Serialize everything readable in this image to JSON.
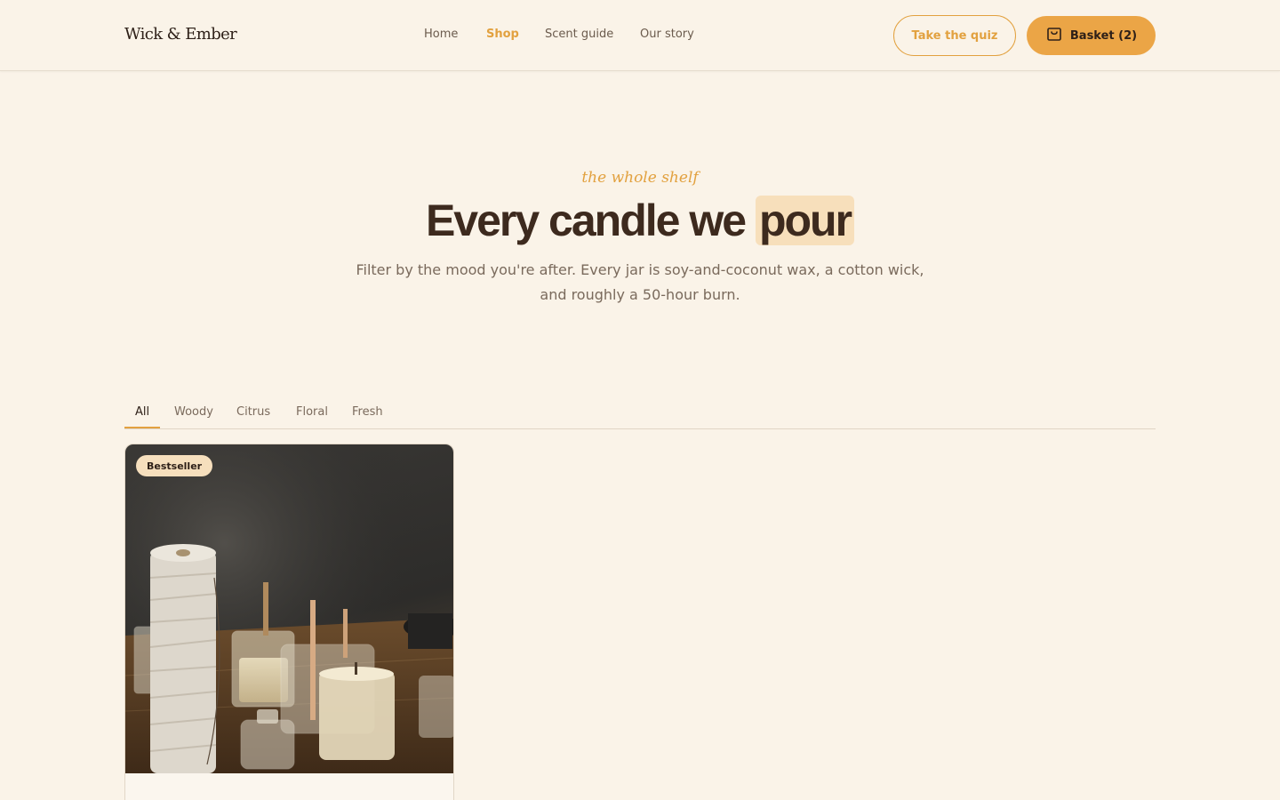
{
  "brand": {
    "logo": "Wick & Ember"
  },
  "nav": {
    "items": [
      {
        "label": "Home",
        "active": false
      },
      {
        "label": "Shop",
        "active": true
      },
      {
        "label": "Scent guide",
        "active": false
      },
      {
        "label": "Our story",
        "active": false
      }
    ]
  },
  "header": {
    "quiz_label": "Take the quiz",
    "basket_label": "Basket (2)"
  },
  "hero": {
    "eyebrow": "the whole shelf",
    "title_main": "Every candle we ",
    "title_highlight": "pour",
    "subtitle_line1": "Filter by the mood you're after. Every jar is soy-and-coconut wax, a cotton wick,",
    "subtitle_line2": "and roughly a 50-hour burn."
  },
  "filters": {
    "tabs": [
      {
        "label": "All",
        "active": true
      },
      {
        "label": "Woody",
        "active": false
      },
      {
        "label": "Citrus",
        "active": false
      },
      {
        "label": "Floral",
        "active": false
      },
      {
        "label": "Fresh",
        "active": false
      }
    ]
  },
  "products": [
    {
      "badge": "Bestseller"
    }
  ],
  "colors": {
    "background": "#faf3e8",
    "accent": "#e2a13f",
    "text": "#3d2a1e",
    "highlight": "#f7dfbb"
  }
}
